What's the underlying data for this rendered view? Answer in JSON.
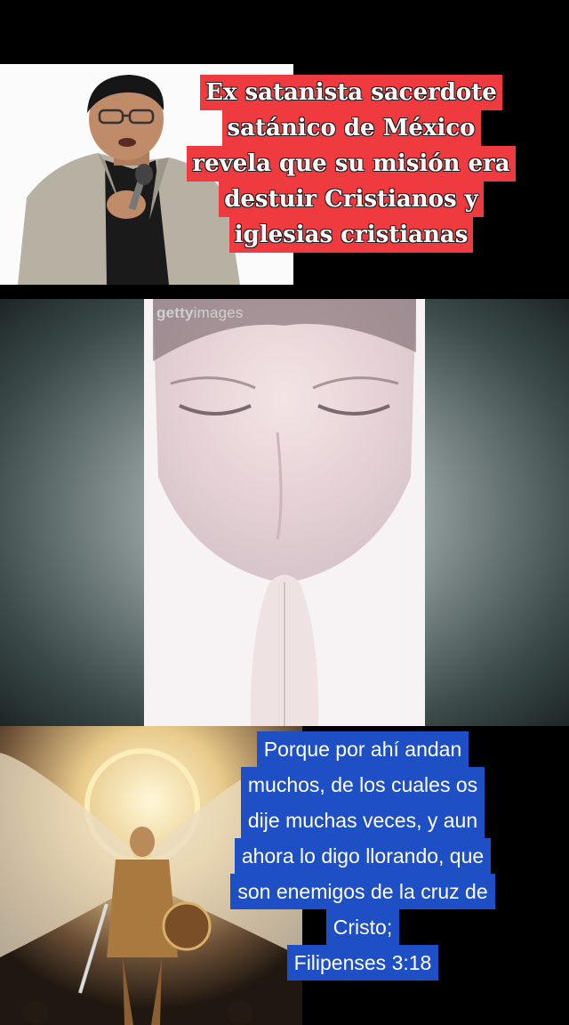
{
  "caption": {
    "lines": [
      "Ex satanista sacerdote",
      "satánico de México",
      "revela que su misión era",
      "destuir Cristianos y",
      "iglesias cristianas"
    ],
    "background": "#ef3a3f",
    "text_color": "#ffffff"
  },
  "watermark": {
    "brand_bold": "getty",
    "brand_light": "images"
  },
  "verse": {
    "lines": [
      "Porque por ahí andan",
      "muchos, de los cuales os",
      "dije muchas veces, y aun",
      "ahora lo digo llorando, que",
      "son enemigos de la cruz de",
      "Cristo;",
      "Filipenses 3:18"
    ],
    "background": "#1f4fc4",
    "text_color": "#ffffff"
  },
  "images": {
    "speaker": "man-speaking-with-microphone",
    "praying": "person-praying-with-closed-eyes",
    "angel": "armored-winged-angel-with-sword-and-shield"
  }
}
